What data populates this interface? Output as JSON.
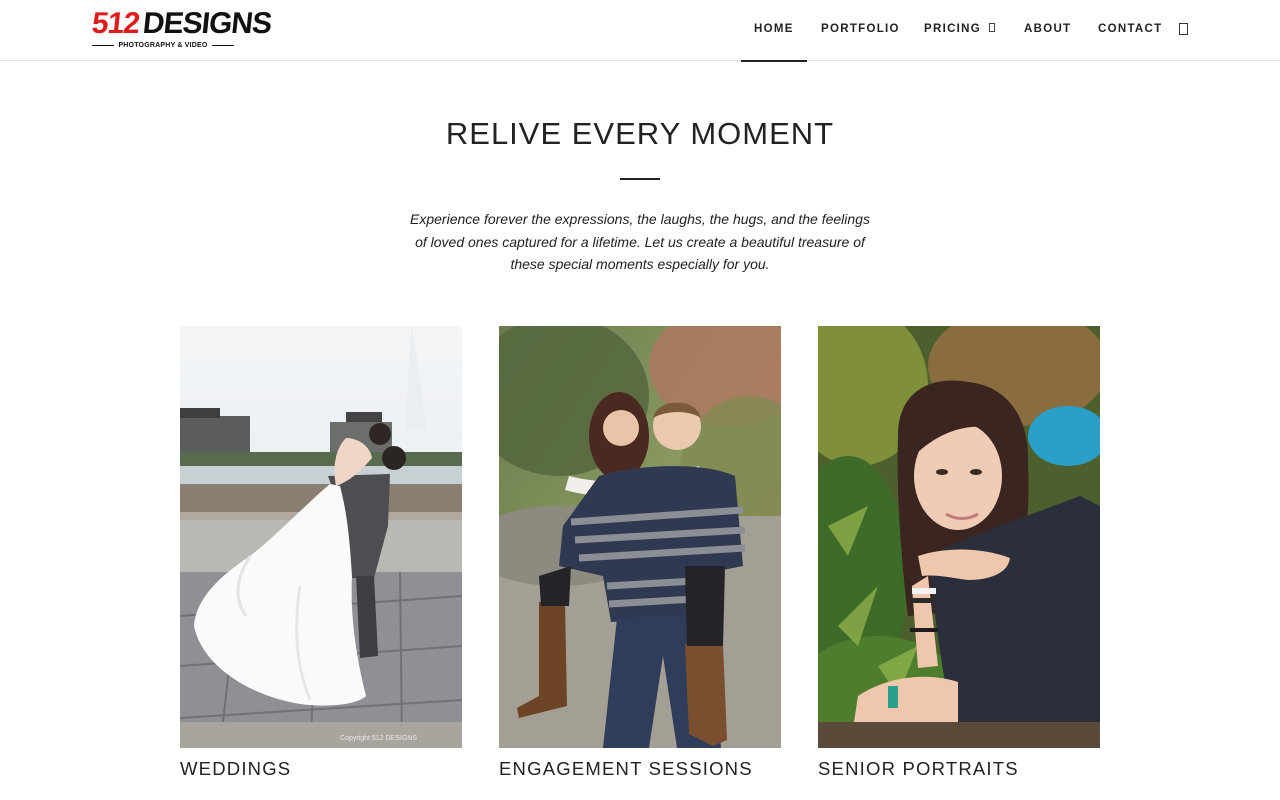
{
  "brand": {
    "logo_number": "512",
    "logo_word": "DESIGNS",
    "logo_tagline": "PHOTOGRAPHY & VIDEO",
    "accent_color": "#e01b1b"
  },
  "nav": {
    "items": [
      {
        "label": "HOME",
        "active": true
      },
      {
        "label": "PORTFOLIO",
        "active": false
      },
      {
        "label": "PRICING",
        "active": false,
        "has_dropdown": true
      },
      {
        "label": "ABOUT",
        "active": false
      },
      {
        "label": "CONTACT",
        "active": false
      }
    ],
    "search_icon": "search-icon",
    "dropdown_icon": "chevron-down-icon"
  },
  "hero": {
    "title": "RELIVE EVERY MOMENT",
    "text_line_1": "Experience forever the expressions, the laughs, the hugs, and the feelings",
    "text_line_2": "of loved ones captured for a lifetime. Let us create a beautiful treasure of",
    "text_line_3": "these special moments especially for you."
  },
  "gallery": [
    {
      "caption": "WEDDINGS",
      "photo_watermark": "Copyright 512 DESIGNS"
    },
    {
      "caption": "ENGAGEMENT SESSIONS"
    },
    {
      "caption": "SENIOR PORTRAITS"
    }
  ]
}
